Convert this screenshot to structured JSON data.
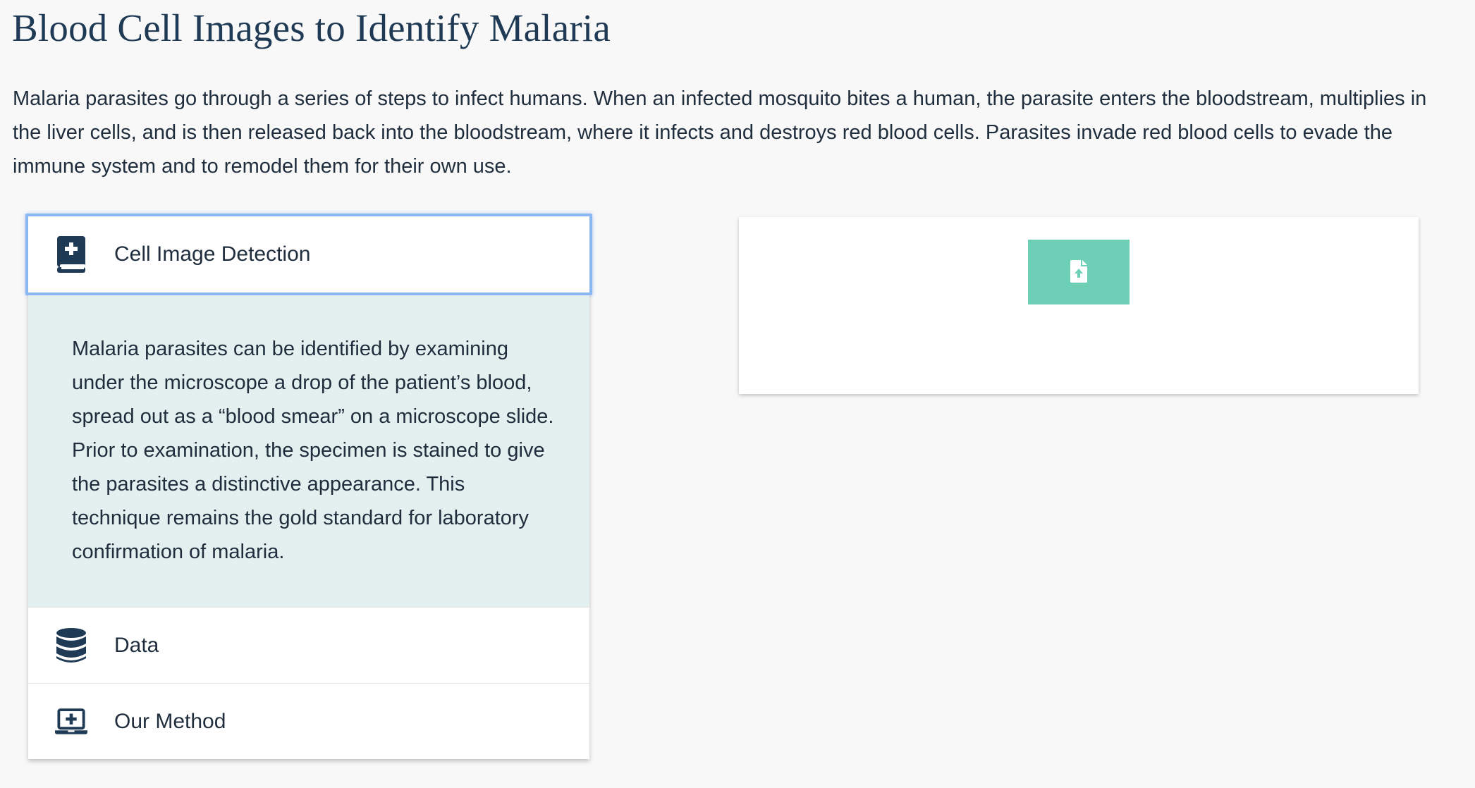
{
  "page": {
    "title": "Blood Cell Images to Identify Malaria",
    "intro": "Malaria parasites go through a series of steps to infect humans. When an infected mosquito bites a human, the parasite enters the bloodstream, multiplies in the liver cells, and is then released back into the bloodstream, where it infects and destroys red blood cells. Parasites invade red blood cells to evade the immune system and to remodel them for their own use."
  },
  "accordion": {
    "items": [
      {
        "label": "Cell Image Detection",
        "icon": "medical-book-icon",
        "expanded": true,
        "body": "Malaria parasites can be identified by examining under the microscope a drop of the patient’s blood, spread out as a “blood smear” on a microscope slide. Prior to examination, the specimen is stained to give the parasites a distinctive appearance. This technique remains the gold standard for laboratory confirmation of malaria."
      },
      {
        "label": "Data",
        "icon": "database-icon",
        "expanded": false
      },
      {
        "label": "Our Method",
        "icon": "laptop-medical-icon",
        "expanded": false
      }
    ]
  },
  "upload": {
    "icon": "file-upload-icon"
  },
  "colors": {
    "accent": "#6dcfb5",
    "panel_body": "#e3f0ef",
    "focus_border": "#8ab6f2",
    "text": "#1f2d3d",
    "icon": "#1f3a55"
  }
}
